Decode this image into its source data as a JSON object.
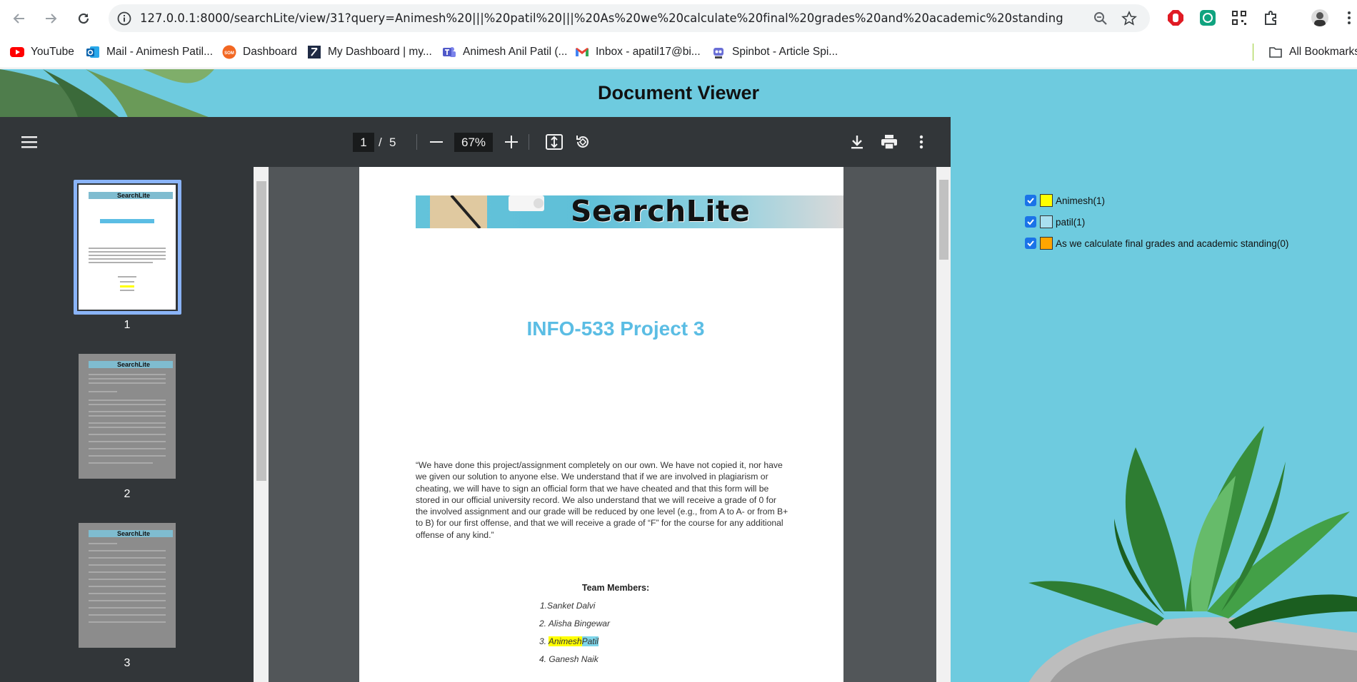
{
  "browser": {
    "url": "127.0.0.1:8000/searchLite/view/31?query=Animesh%20|||%20patil%20|||%20As%20we%20calculate%20final%20grades%20and%20academic%20standing",
    "bookmarks": [
      {
        "label": "YouTube",
        "icon": "youtube-icon"
      },
      {
        "label": "Mail - Animesh Patil...",
        "icon": "outlook-icon"
      },
      {
        "label": "Dashboard",
        "icon": "dashboard-icon"
      },
      {
        "label": "My Dashboard | my...",
        "icon": "myd-icon"
      },
      {
        "label": "Animesh Anil Patil (...",
        "icon": "teams-icon"
      },
      {
        "label": "Inbox - apatil17@bi...",
        "icon": "gmail-icon"
      },
      {
        "label": "Spinbot - Article Spi...",
        "icon": "spinbot-icon"
      }
    ],
    "all_bookmarks": "All Bookmarks"
  },
  "page": {
    "title": "Document Viewer"
  },
  "viewer": {
    "current_page": "1",
    "separator": "/",
    "total_pages": "5",
    "zoom": "67%",
    "thumbnails": [
      {
        "num": "1",
        "banner": "SearchLite"
      },
      {
        "num": "2",
        "banner": "SearchLite"
      },
      {
        "num": "3",
        "banner": "SearchLite"
      }
    ]
  },
  "document": {
    "banner": "SearchLite",
    "title": "INFO-533 Project 3",
    "statement": "“We have done this project/assignment completely on our own. We have not copied it, nor have we given our solution to anyone else. We understand that if we are involved in plagiarism or cheating, we will have to sign an official form that we have cheated and that this form will be stored in our official university record. We also understand that we will receive a grade of 0 for the involved assignment and our grade will be reduced by one level (e.g., from A to A- or from B+ to B) for our first offense, and that we will receive a grade of “F” for the course for any additional offense of any kind.”",
    "team_heading": "Team Members:",
    "members": {
      "m1": "1.Sanket Dalvi",
      "m2": "2. Alisha Bingewar",
      "m3_prefix": "3. ",
      "m3_first": "Animesh",
      "m3_last": "Patil",
      "m4": "4. Ganesh Naik"
    }
  },
  "legend": [
    {
      "label": "Animesh(1)",
      "color": "#ffff00",
      "checked": true
    },
    {
      "label": "patil(1)",
      "color": "#a9dff0",
      "checked": true
    },
    {
      "label": "As we calculate final grades and academic standing(0)",
      "color": "#ffa500",
      "checked": true
    }
  ]
}
